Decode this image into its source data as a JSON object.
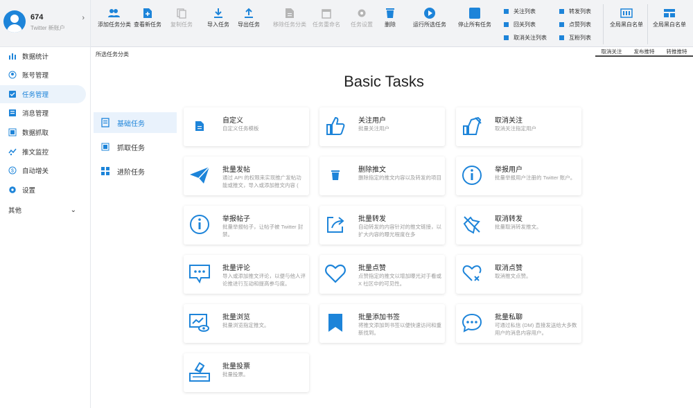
{
  "profile": {
    "name": "674",
    "subtitle": "Twitter 新账户"
  },
  "nav": [
    {
      "label": "数据统计",
      "icon": "bar-chart-icon"
    },
    {
      "label": "账号管理",
      "icon": "user-circle-icon"
    },
    {
      "label": "任务管理",
      "icon": "task-list-icon",
      "active": true
    },
    {
      "label": "消息管理",
      "icon": "message-icon"
    },
    {
      "label": "数据抓取",
      "icon": "grab-icon"
    },
    {
      "label": "推文监控",
      "icon": "monitor-icon"
    },
    {
      "label": "自动增关",
      "icon": "auto-follow-icon"
    },
    {
      "label": "设置",
      "icon": "gear-icon"
    }
  ],
  "nav_other": "其他",
  "toolbar": [
    {
      "label": "添加任务分类",
      "icon": "add-group-icon"
    },
    {
      "label": "查看新任务",
      "icon": "file-plus-icon"
    },
    {
      "label": "复制任务",
      "icon": "copy-icon",
      "disabled": true
    },
    {
      "label": "导入任务",
      "icon": "download-icon"
    },
    {
      "label": "导出任务",
      "icon": "upload-icon"
    },
    {
      "label": "移除任务分类",
      "icon": "file-icon",
      "disabled": true
    },
    {
      "label": "任务重命名",
      "icon": "calendar-icon",
      "disabled": true
    },
    {
      "label": "任务设置",
      "icon": "gear-icon",
      "disabled": true
    },
    {
      "label": "删除",
      "icon": "trash-icon"
    },
    {
      "label": "运行所选任务",
      "icon": "play-icon"
    },
    {
      "label": "停止所有任务",
      "icon": "stop-icon"
    }
  ],
  "checkboxes": [
    {
      "label": "关注列表"
    },
    {
      "label": "回关列表"
    },
    {
      "label": "取消关注列表"
    },
    {
      "label": "转发列表"
    },
    {
      "label": "点赞列表"
    },
    {
      "label": "互粉列表"
    }
  ],
  "toolbar_right": [
    {
      "label": "全局黑白名单",
      "icon": "list-icon"
    },
    {
      "label": "全局黑白名单",
      "icon": "layout-icon"
    }
  ],
  "tabs": [
    "取消关注",
    "发布推特",
    "转推推特"
  ],
  "breadcrumb": "所选任务分类",
  "page_title": "Basic Tasks",
  "subnav": [
    {
      "label": "基础任务",
      "icon": "doc-icon",
      "active": true
    },
    {
      "label": "抓取任务",
      "icon": "grab-icon"
    },
    {
      "label": "进阶任务",
      "icon": "grid-icon"
    }
  ],
  "cards": [
    {
      "title": "自定义",
      "desc": "自定义任务模板",
      "icon": "file-icon"
    },
    {
      "title": "关注用户",
      "desc": "批量关注用户",
      "icon": "thumbs-up-icon"
    },
    {
      "title": "取消关注",
      "desc": "取消关注指定用户",
      "icon": "thumbs-down-icon"
    },
    {
      "title": "批量发帖",
      "desc": "通过 API 的权限来实现推广发帖功能或推文，导入或添加推文内容 (",
      "icon": "send-icon"
    },
    {
      "title": "删除推文",
      "desc": "删除指定的推文内容以及转发的项目",
      "icon": "trash-icon"
    },
    {
      "title": "举报用户",
      "desc": "批量举报用户注册的 Twitter 账户。",
      "icon": "info-icon"
    },
    {
      "title": "举报帖子",
      "desc": "批量举报帖子，让帖子被 Twitter 封禁。",
      "icon": "info-icon"
    },
    {
      "title": "批量转发",
      "desc": "自动转发的内容针对的推文链接，以扩大内容的曝光程度在多",
      "icon": "share-icon"
    },
    {
      "title": "取消转发",
      "desc": "批量取消转发推文。",
      "icon": "unshare-icon"
    },
    {
      "title": "批量评论",
      "desc": "导入或添加推文评论，以便与他人评论推进行互动和提高参与度。",
      "icon": "comment-icon"
    },
    {
      "title": "批量点赞",
      "desc": "点赞指定的推文以增加曝光对于看或 X 社区中的可见性。",
      "icon": "heart-icon"
    },
    {
      "title": "取消点赞",
      "desc": "取消推文点赞。",
      "icon": "heart-x-icon"
    },
    {
      "title": "批量浏览",
      "desc": "批量浏览指定推文。",
      "icon": "view-icon"
    },
    {
      "title": "批量添加书签",
      "desc": "将推文添加到书签以便快速访问和重新找到。",
      "icon": "bookmark-icon"
    },
    {
      "title": "批量私聊",
      "desc": "可通过私信 (DM) 直接发送给大多数用户的消息内容用户。",
      "icon": "chat-icon"
    },
    {
      "title": "批量投票",
      "desc": "批量投票。",
      "icon": "vote-icon"
    }
  ]
}
